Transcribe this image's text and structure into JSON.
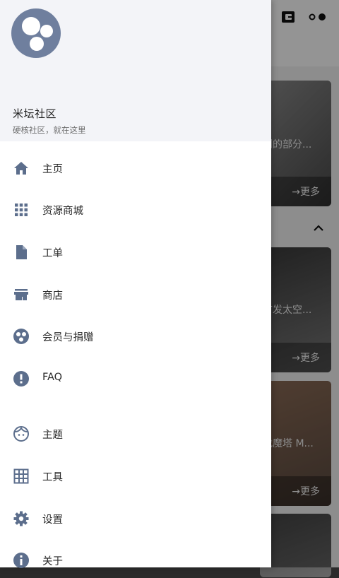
{
  "drawer": {
    "app_name": "米坛社区",
    "tagline": "硬核社区，就在这里",
    "items": [
      {
        "label": "主页",
        "icon": "home-icon"
      },
      {
        "label": "资源商城",
        "icon": "grid-icon"
      },
      {
        "label": "工单",
        "icon": "document-icon"
      },
      {
        "label": "商店",
        "icon": "store-icon"
      },
      {
        "label": "会员与捐赠",
        "icon": "membership-icon"
      },
      {
        "label": "FAQ",
        "icon": "alert-circle-icon"
      },
      {
        "label": "主题",
        "icon": "face-icon"
      },
      {
        "label": "工具",
        "icon": "table-icon"
      },
      {
        "label": "设置",
        "icon": "gear-icon"
      },
      {
        "label": "关于",
        "icon": "info-icon"
      }
    ]
  },
  "background": {
    "cards": [
      {
        "caption": "到的部分...",
        "more": "→更多"
      },
      {
        "caption": "首发太空...",
        "more": "→更多"
      },
      {
        "caption": "找魔塔 M...",
        "more": "→更多"
      }
    ]
  },
  "colors": {
    "icon": "#5c6e8c",
    "header_bg": "#f3f4f8",
    "avatar": "#6f7f9e"
  }
}
